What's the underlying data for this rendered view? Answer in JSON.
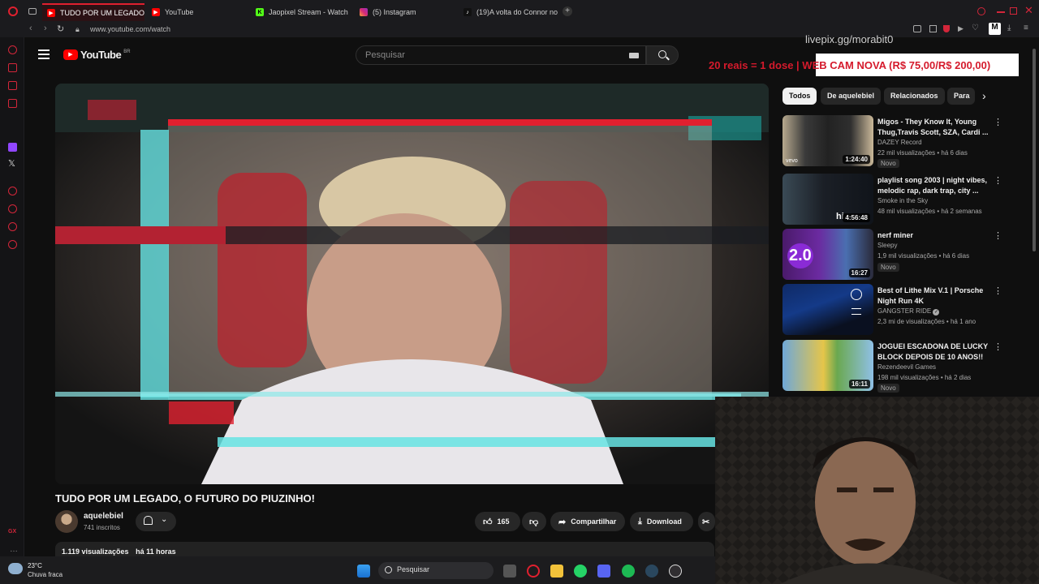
{
  "browser": {
    "tabs": [
      {
        "label": "TUDO POR UM LEGADO,",
        "active": true
      },
      {
        "label": "YouTube"
      },
      {
        "label": "Jaopixel Stream - Watch"
      },
      {
        "label": "(5) Instagram"
      },
      {
        "label": "(19)A volta do Connor no"
      }
    ],
    "url": "www.youtube.com/watch"
  },
  "youtube": {
    "logo": "YouTube",
    "region": "BR",
    "search_placeholder": "Pesquisar",
    "chips": [
      "Todos",
      "De aquelebiel",
      "Relacionados",
      "Para"
    ],
    "video": {
      "title": "TUDO POR UM LEGADO, O FUTURO DO PIUZINHO!",
      "channel": "aquelebiel",
      "subscribers": "741 inscritos",
      "likes": "165",
      "share_label": "Compartilhar",
      "download_label": "Download",
      "views": "1.119 visualizações",
      "age": "há 11 horas"
    },
    "recommendations": [
      {
        "title": "Migos - They Know It, Young Thug,Travis Scott, SZA, Cardi ...",
        "channel": "DAZEY Record",
        "meta": "22 mil visualizações • há 6 dias",
        "badge": "Novo",
        "duration": "1:24:40",
        "thumb_label": "vevo"
      },
      {
        "title": "playlist song 2003 | night vibes, melodic rap, dark trap, city ...",
        "channel": "Smoke in the Sky",
        "meta": "48 mil visualizações • há 2 semanas",
        "badge": "",
        "duration": "4:56:48",
        "thumb_label": "hi"
      },
      {
        "title": "nerf miner",
        "channel": "Sleepy",
        "meta": "1,9 mil visualizações • há 6 dias",
        "badge": "Novo",
        "duration": "16:27",
        "thumb_label": "2.0"
      },
      {
        "title": "Best of Lithe Mix V.1 | Porsche Night Run 4K",
        "channel": "GANGSTER RIDE",
        "meta": "2,3 mi de visualizações • há 1 ano",
        "badge": "",
        "duration": "",
        "thumb_label": ""
      },
      {
        "title": "JOGUEI ESCADONA DE LUCKY BLOCK DEPOIS DE 10 ANOS!!",
        "channel": "Rezendeevil Games",
        "meta": "198 mil visualizações • há 2 dias",
        "badge": "Novo",
        "duration": "16:11",
        "thumb_label": ""
      }
    ]
  },
  "overlay": {
    "livepix": "livepix.gg/morabit0",
    "banner": "20 reais = 1 dose | WEB CAM NOVA (R$ 75,00/R$ 200,00)"
  },
  "taskbar": {
    "temperature": "23°C",
    "weather": "Chuva fraca",
    "search": "Pesquisar"
  },
  "colors": {
    "accent": "#e0202f",
    "yt_red": "#ff0000",
    "banner_text": "#d51a2c"
  }
}
